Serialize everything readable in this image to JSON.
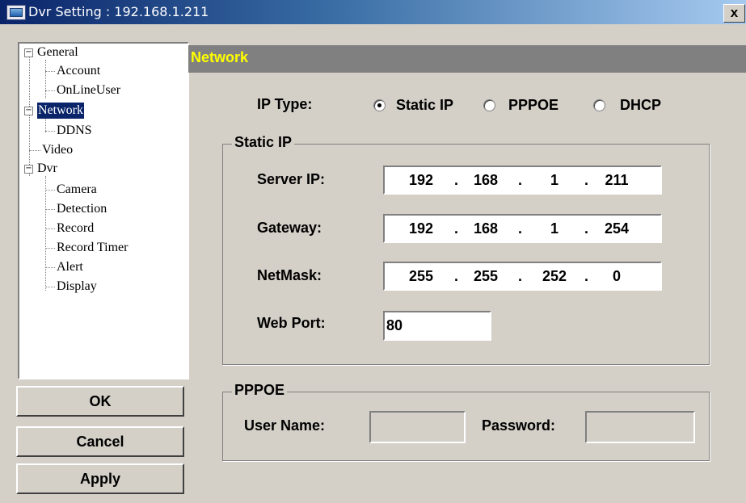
{
  "window": {
    "title": "Dvr Setting : 192.168.1.211",
    "close_label": "x"
  },
  "tree": {
    "general": "General",
    "account": "Account",
    "onlineuser": "OnLineUser",
    "network": "Network",
    "ddns": "DDNS",
    "video": "Video",
    "dvr": "Dvr",
    "camera": "Camera",
    "detection": "Detection",
    "record": "Record",
    "record_timer": "Record Timer",
    "alert": "Alert",
    "display": "Display",
    "collapse_glyph": "−"
  },
  "buttons": {
    "ok": "OK",
    "cancel": "Cancel",
    "apply": "Apply"
  },
  "panel": {
    "title": "Network",
    "ip_type": {
      "label": "IP Type:",
      "options": [
        "Static IP",
        "PPPOE",
        "DHCP"
      ],
      "selected": "Static IP"
    },
    "static_ip": {
      "group_title": "Static IP",
      "server_ip": {
        "label": "Server IP:",
        "octets": [
          "192",
          "168",
          "1",
          "211"
        ]
      },
      "gateway": {
        "label": "Gateway:",
        "octets": [
          "192",
          "168",
          "1",
          "254"
        ]
      },
      "netmask": {
        "label": "NetMask:",
        "octets": [
          "255",
          "255",
          "252",
          "0"
        ]
      },
      "web_port": {
        "label": "Web Port:",
        "value": "80"
      },
      "separator": "."
    },
    "pppoe": {
      "group_title": "PPPOE",
      "user_name": {
        "label": "User Name:",
        "value": ""
      },
      "password": {
        "label": "Password:",
        "value": ""
      }
    }
  },
  "colors": {
    "title_bar": "#0a246a",
    "header_bg": "#808080",
    "header_text": "#ffff00",
    "dialog_bg": "#d4d0c8"
  }
}
